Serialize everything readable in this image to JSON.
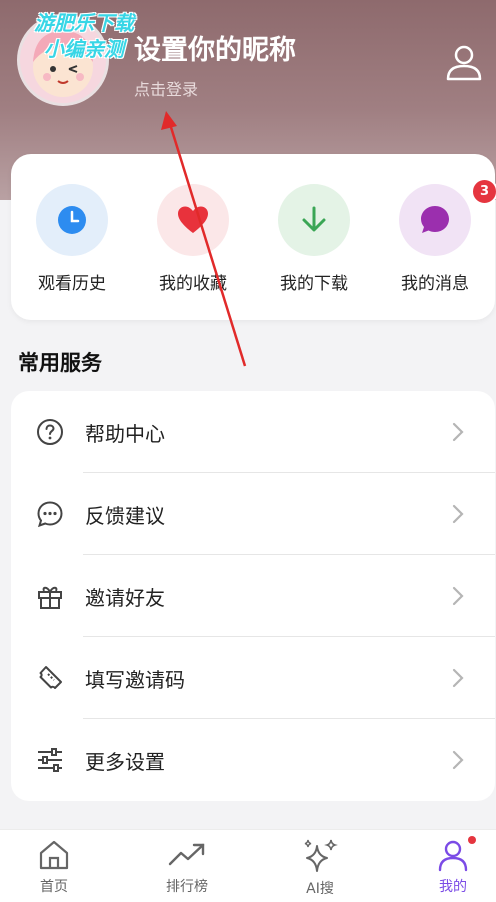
{
  "header": {
    "watermark_line1": "游肥乐下载",
    "watermark_line2": "小编亲测",
    "nickname": "设置你的昵称",
    "login_hint": "点击登录"
  },
  "quick_actions": [
    {
      "label": "观看历史",
      "icon": "clock-icon",
      "bg": "#e3eefa",
      "color": "#2d8cf0"
    },
    {
      "label": "我的收藏",
      "icon": "heart-icon",
      "bg": "#fbe7e8",
      "color": "#e8323c"
    },
    {
      "label": "我的下载",
      "icon": "download-icon",
      "bg": "#e4f3e6",
      "color": "#3aa655"
    },
    {
      "label": "我的消息",
      "icon": "message-icon",
      "bg": "#f1e3f5",
      "color": "#9b2fae",
      "badge": "3"
    }
  ],
  "services": {
    "title": "常用服务",
    "items": [
      {
        "label": "帮助中心",
        "icon": "help-circle-icon"
      },
      {
        "label": "反馈建议",
        "icon": "chat-bubble-icon"
      },
      {
        "label": "邀请好友",
        "icon": "gift-icon"
      },
      {
        "label": "填写邀请码",
        "icon": "ticket-icon"
      },
      {
        "label": "更多设置",
        "icon": "sliders-icon"
      }
    ]
  },
  "tabbar": {
    "items": [
      {
        "label": "首页",
        "icon": "home-icon"
      },
      {
        "label": "排行榜",
        "icon": "trending-icon"
      },
      {
        "label": "AI搜",
        "icon": "sparkle-icon"
      },
      {
        "label": "我的",
        "icon": "user-icon",
        "active": true
      }
    ]
  },
  "colors": {
    "accent": "#7b4be6",
    "badge": "#e5353f",
    "header": "#8e6a6d"
  }
}
